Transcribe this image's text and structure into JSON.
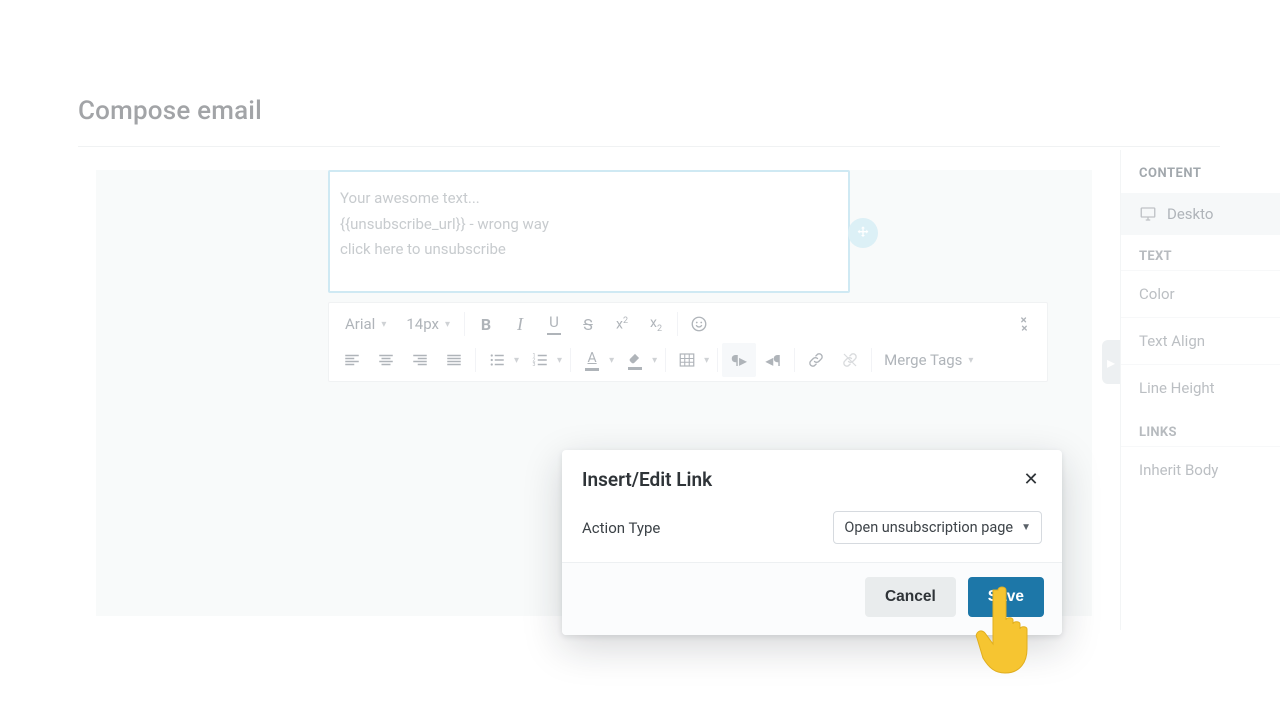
{
  "header": {
    "title": "Compose email"
  },
  "editor": {
    "lines": {
      "l1": "Your awesome text...",
      "l2": "{{unsubscribe_url}} - wrong way",
      "l3": "click here to unsubscribe"
    },
    "font_family": "Arial",
    "font_size": "14px",
    "merge_tags_label": "Merge Tags"
  },
  "sidebar": {
    "section_content": "CONTENT",
    "desktop_label": "Deskto",
    "section_text": "TEXT",
    "items": {
      "color": "Color",
      "text_align": "Text Align",
      "line_height": "Line Height"
    },
    "section_links": "LINKS",
    "inherit": "Inherit Body"
  },
  "modal": {
    "title": "Insert/Edit Link",
    "action_type_label": "Action Type",
    "action_type_value": "Open unsubscription page",
    "cancel": "Cancel",
    "save": "Save"
  }
}
